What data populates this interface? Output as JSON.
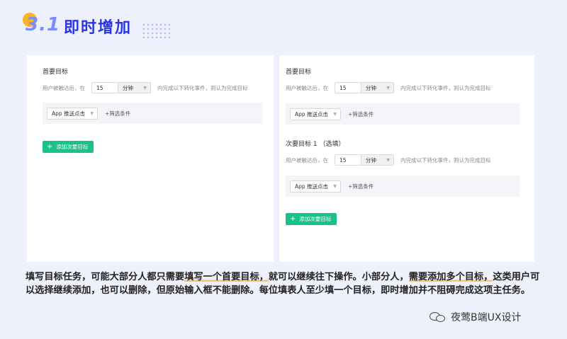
{
  "header": {
    "number": "3.1",
    "title": "即时增加"
  },
  "left_panel": {
    "primary_title": "首要目标",
    "cond_prefix": "用户被触达后，在",
    "minutes": "15",
    "unit": "分钟",
    "cond_suffix": "内完成以下转化事件，则认为完成目标",
    "event_select": "App 推送点击",
    "add_filter": "+筛选条件",
    "add_secondary": "添加次要目标"
  },
  "right_panel": {
    "primary_title": "首要目标",
    "cond_prefix": "用户被触达后，在",
    "minutes": "15",
    "unit": "分钟",
    "cond_suffix": "内完成以下转化事件，则认为完成目标",
    "event_select": "App 推送点击",
    "add_filter": "+筛选条件",
    "secondary_title": "次要目标 1 （选填）",
    "sec_cond_prefix": "用户被触达后，在",
    "sec_minutes": "15",
    "sec_unit": "分钟",
    "sec_cond_suffix": "内完成以下转化事件，则认为完成目标",
    "sec_event_select": "App 推送点击",
    "sec_add_filter": "+筛选条件",
    "add_secondary": "添加次要目标"
  },
  "paragraph": {
    "p1": "填写目标任务，可能大部分人都只需要",
    "h1": "填写一个首要目标，",
    "p2": "就可以继续往下操作。小部分人，",
    "h2": "需要添加多个目标，",
    "p3": "这类用户可以选择继续添加，也可以删除，但原始输入框不能删除。每位填表人至少填一个目标，即时增加并不阻碍完成这项主任务。"
  },
  "watermark": {
    "text": "夜莺B端UX设计"
  },
  "colors": {
    "accent_green": "#19c28a",
    "title_blue": "#2a35e8",
    "highlight": "#f7c66e"
  }
}
